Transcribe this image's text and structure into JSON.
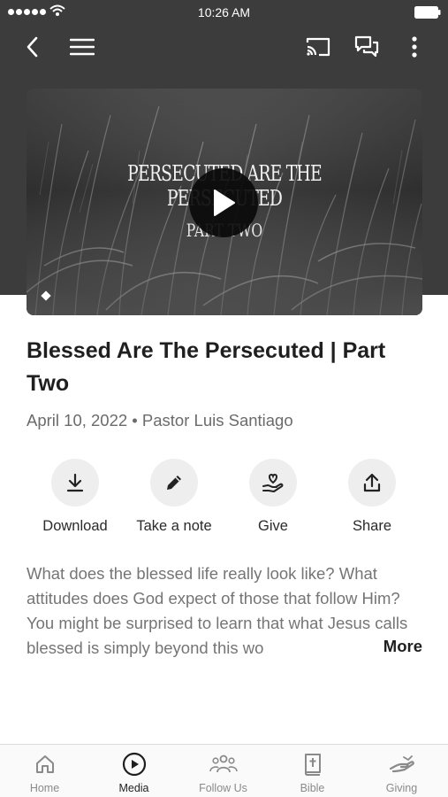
{
  "status_bar": {
    "time": "10:26 AM"
  },
  "navbar": {
    "back_icon": "chevron-left-icon",
    "menu_icon": "hamburger-menu-icon",
    "cast_icon": "cast-icon",
    "chat_icon": "chat-bubbles-icon",
    "more_icon": "more-vertical-icon"
  },
  "video": {
    "title_text": "PERSECUTED ARE THE PERSECUTED",
    "subtitle_text": "PART TWO",
    "play_icon": "play-icon"
  },
  "sermon": {
    "title": "Blessed Are The Persecuted | Part Two",
    "meta": "April 10, 2022 • Pastor Luis Santiago"
  },
  "actions": [
    {
      "label": "Download",
      "icon": "download-icon"
    },
    {
      "label": "Take a note",
      "icon": "pencil-icon"
    },
    {
      "label": "Give",
      "icon": "give-hand-heart-icon"
    },
    {
      "label": "Share",
      "icon": "share-icon"
    }
  ],
  "description": {
    "text": "What does the blessed life really look like? What attitudes does God expect of those that follow Him? You might be surprised to learn that what Jesus calls blessed is simply beyond this wo",
    "more_label": "More"
  },
  "tabs": [
    {
      "label": "Home",
      "icon": "home-icon",
      "active": false
    },
    {
      "label": "Media",
      "icon": "play-circle-icon",
      "active": true
    },
    {
      "label": "Follow Us",
      "icon": "people-icon",
      "active": false
    },
    {
      "label": "Bible",
      "icon": "bible-icon",
      "active": false
    },
    {
      "label": "Giving",
      "icon": "giving-hand-icon",
      "active": false
    }
  ],
  "colors": {
    "header_background": "#3c3c3c",
    "action_circle": "#eeeeee",
    "text_primary": "#1f1f1f",
    "text_secondary": "#6b6b6b",
    "tab_inactive": "#8a8a8a"
  }
}
